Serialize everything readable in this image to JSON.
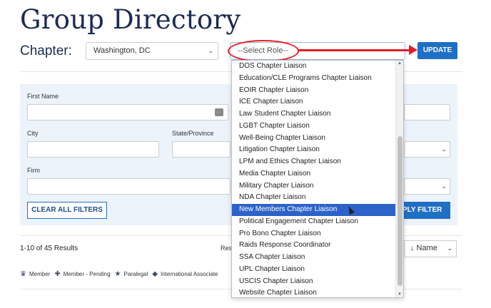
{
  "header": {
    "title": "Group Directory"
  },
  "chapter": {
    "label": "Chapter:",
    "selected": "Washington, DC"
  },
  "role": {
    "selected": "--Select Role--"
  },
  "update_label": "UPDATE",
  "filters": {
    "first_name_label": "First Name",
    "city_label": "City",
    "state_label": "State/Province",
    "firm_label": "Firm",
    "clear_label": "CLEAR ALL FILTERS",
    "apply_label": "PLY FILTER"
  },
  "results": {
    "count_text": "1-10 of 45 Results",
    "res_partial": "Res",
    "sort_label": "↓ Name"
  },
  "legend": [
    {
      "icon": "crown-icon",
      "glyph": "♛",
      "label": "Member"
    },
    {
      "icon": "plus-icon",
      "glyph": "✚",
      "label": "Member - Pending"
    },
    {
      "icon": "star-icon",
      "glyph": "★",
      "label": "Paralegal"
    },
    {
      "icon": "diamond-icon",
      "glyph": "◆",
      "label": "International Associate"
    }
  ],
  "role_options": [
    "DOS Chapter Liaison",
    "Education/CLE Programs Chapter Liaison",
    "EOIR Chapter Liaison",
    "ICE Chapter Liaison",
    "Law Student Chapter Liaison",
    "LGBT Chapter Liaison",
    "Well-Being Chapter Liaison",
    "Litigation Chapter Liaison",
    "LPM and Ethics Chapter Liaison",
    "Media Chapter Liaison",
    "Military Chapter Liaison",
    "NDA Chapter Liaison",
    "New Members Chapter Liaison",
    "Political Engagement Chapter Liaison",
    "Pro Bono Chapter Liaison",
    "Raids Response Coordinator",
    "SSA Chapter Liaison",
    "UPL Chapter Liaison",
    "USCIS Chapter Liaison",
    "Website Chapter Liaison"
  ],
  "highlighted_option": "New Members Chapter Liaison",
  "colors": {
    "primary": "#1f6fc5",
    "title": "#1c2b52",
    "annotation": "#e21f26",
    "highlight": "#2d63c8"
  }
}
